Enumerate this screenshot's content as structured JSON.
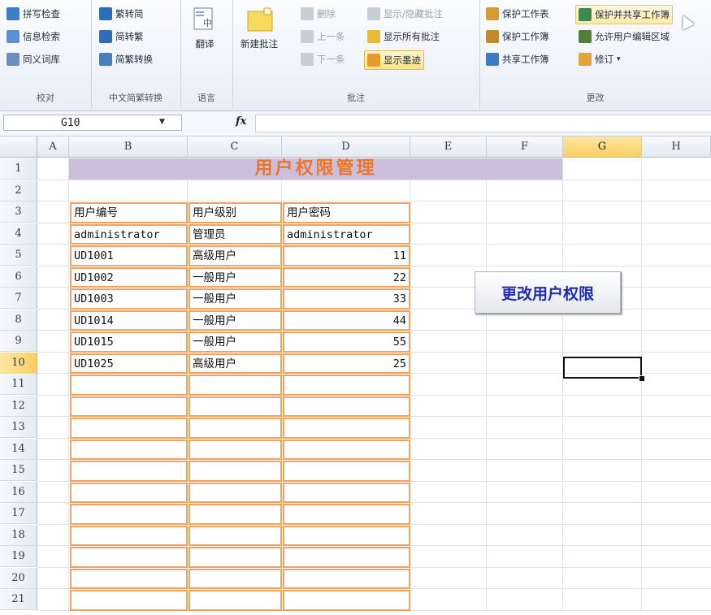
{
  "ribbon": {
    "proofing": {
      "label": "校对",
      "spell_check": "拼写检查",
      "research": "信息检索",
      "thesaurus": "同义词库"
    },
    "chinese_conversion": {
      "label": "中文简繁转换",
      "to_simplified": "繁转简",
      "to_traditional": "简转繁",
      "convert": "简繁转换"
    },
    "language": {
      "label": "语言",
      "translate": "翻译"
    },
    "comments": {
      "label": "批注",
      "new_comment": "新建批注",
      "delete": "删除",
      "previous": "上一条",
      "next": "下一条",
      "show_hide": "显示/隐藏批注",
      "show_all": "显示所有批注",
      "show_ink": "显示墨迹"
    },
    "changes": {
      "label": "更改",
      "protect_sheet": "保护工作表",
      "protect_workbook": "保护工作簿",
      "share_workbook": "共享工作簿",
      "protect_and_share": "保护并共享工作簿",
      "allow_edit_ranges": "允许用户编辑区域",
      "track_changes": "修订"
    }
  },
  "formula_bar": {
    "name_box": "G10",
    "fx": "fx",
    "formula": ""
  },
  "columns": [
    "A",
    "B",
    "C",
    "D",
    "E",
    "F",
    "G",
    "H"
  ],
  "rows": [
    "1",
    "2",
    "3",
    "4",
    "5",
    "6",
    "7",
    "8",
    "9",
    "10",
    "11",
    "12",
    "13",
    "14",
    "15",
    "16",
    "17",
    "18",
    "19",
    "20",
    "21"
  ],
  "sheet": {
    "title": "用户权限管理",
    "headers": [
      "用户编号",
      "用户级别",
      "用户密码"
    ],
    "data": [
      [
        "administrator",
        "管理员",
        "administrator"
      ],
      [
        "UD1001",
        "高级用户",
        "11"
      ],
      [
        "UD1002",
        "一般用户",
        "22"
      ],
      [
        "UD1003",
        "一般用户",
        "33"
      ],
      [
        "UD1014",
        "一般用户",
        "44"
      ],
      [
        "UD1015",
        "一般用户",
        "55"
      ],
      [
        "UD1025",
        "高级用户",
        "25"
      ]
    ],
    "macro_button": "更改用户权限",
    "selected_cell": "G10"
  },
  "colors": {
    "title_band": "#cdbfdc",
    "title_text": "#e8772a",
    "cell_border": "#f0a25e",
    "button_text": "#1f2bb8",
    "selected_header": "#f8cf61"
  }
}
